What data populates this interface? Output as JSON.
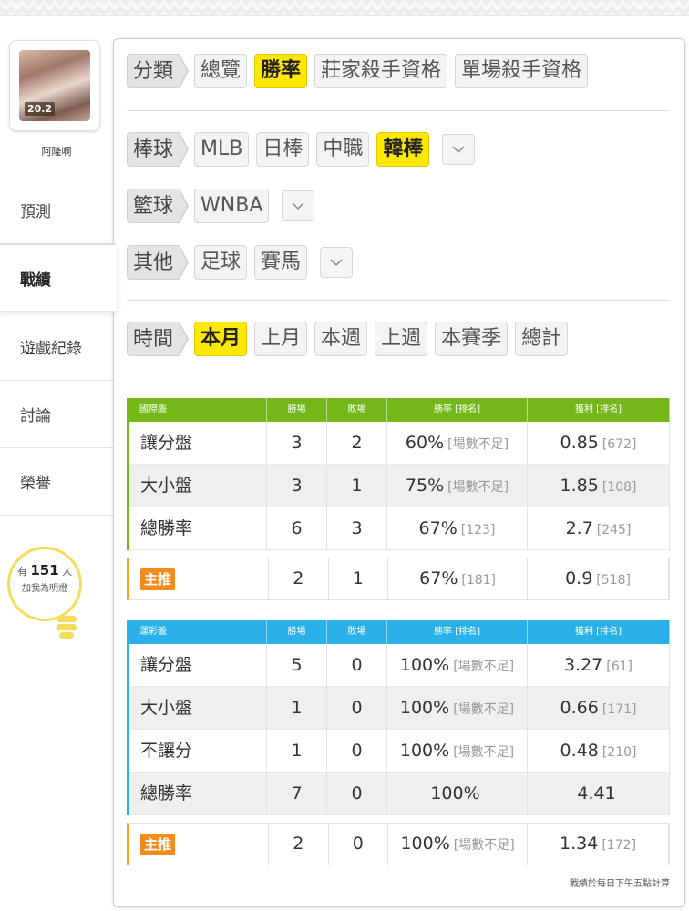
{
  "user": {
    "name": "阿隆啊",
    "avatar_number": "20.2"
  },
  "sidebar": {
    "items": [
      {
        "label": "預測",
        "active": false
      },
      {
        "label": "戰績",
        "active": true
      },
      {
        "label": "遊戲紀錄",
        "active": false
      },
      {
        "label": "討論",
        "active": false
      },
      {
        "label": "榮譽",
        "active": false
      }
    ],
    "fans": {
      "prefix": "有",
      "count": "151",
      "suffix": "人",
      "subtitle": "加我為明燈"
    }
  },
  "filters": {
    "category": {
      "label": "分類",
      "options": [
        "總覽",
        "勝率",
        "莊家殺手資格",
        "單場殺手資格"
      ],
      "selected": "勝率"
    },
    "baseball": {
      "label": "棒球",
      "options": [
        "MLB",
        "日棒",
        "中職",
        "韓棒"
      ],
      "selected": "韓棒"
    },
    "basketball": {
      "label": "籃球",
      "options": [
        "WNBA"
      ]
    },
    "other": {
      "label": "其他",
      "options": [
        "足球",
        "賽馬"
      ]
    },
    "time": {
      "label": "時間",
      "options": [
        "本月",
        "上月",
        "本週",
        "上週",
        "本賽季",
        "總計"
      ],
      "selected": "本月"
    }
  },
  "international": {
    "headers": [
      "國際盤",
      "勝場",
      "敗場",
      "勝率 [排名]",
      "獲利 [排名]"
    ],
    "rows": [
      {
        "name": "讓分盤",
        "win": "3",
        "loss": "2",
        "rate": "60%",
        "rate_rank": "[場數不足]",
        "profit": "0.85",
        "profit_rank": "[672]"
      },
      {
        "name": "大小盤",
        "win": "3",
        "loss": "1",
        "rate": "75%",
        "rate_rank": "[場數不足]",
        "profit": "1.85",
        "profit_rank": "[108]"
      },
      {
        "name": "總勝率",
        "win": "6",
        "loss": "3",
        "rate": "67%",
        "rate_rank": "[123]",
        "profit": "2.7",
        "profit_rank": "[245]"
      }
    ],
    "featured": {
      "tag": "主推",
      "win": "2",
      "loss": "1",
      "rate": "67%",
      "rate_rank": "[181]",
      "profit": "0.9",
      "profit_rank": "[518]"
    }
  },
  "lottery": {
    "headers": [
      "運彩盤",
      "勝場",
      "敗場",
      "勝率 [排名]",
      "獲利 [排名]"
    ],
    "rows": [
      {
        "name": "讓分盤",
        "win": "5",
        "loss": "0",
        "rate": "100%",
        "rate_rank": "[場數不足]",
        "profit": "3.27",
        "profit_rank": "[61]"
      },
      {
        "name": "大小盤",
        "win": "1",
        "loss": "0",
        "rate": "100%",
        "rate_rank": "[場數不足]",
        "profit": "0.66",
        "profit_rank": "[171]"
      },
      {
        "name": "不讓分",
        "win": "1",
        "loss": "0",
        "rate": "100%",
        "rate_rank": "[場數不足]",
        "profit": "0.48",
        "profit_rank": "[210]"
      },
      {
        "name": "總勝率",
        "win": "7",
        "loss": "0",
        "rate": "100%",
        "rate_rank": "",
        "profit": "4.41",
        "profit_rank": ""
      }
    ],
    "featured": {
      "tag": "主推",
      "win": "2",
      "loss": "0",
      "rate": "100%",
      "rate_rank": "[場數不足]",
      "profit": "1.34",
      "profit_rank": "[172]"
    }
  },
  "footnote": "戰績於每日下午五點計算",
  "colors": {
    "green": "#73b818",
    "blue": "#2ab0e8",
    "highlight": "#ffe800",
    "tag": "#f38b1c"
  }
}
